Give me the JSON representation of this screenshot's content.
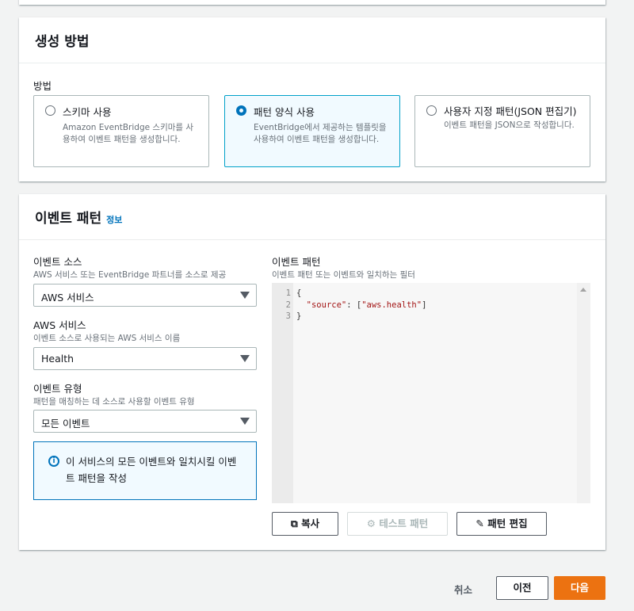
{
  "method_panel": {
    "title": "생성 방법",
    "label": "방법",
    "options": [
      {
        "label": "스키마 사용",
        "desc": "Amazon EventBridge 스키마를 사용하여 이벤트 패턴을 생성합니다.",
        "selected": false
      },
      {
        "label": "패턴 양식 사용",
        "desc": "EventBridge에서 제공하는 템플릿을 사용하여 이벤트 패턴을 생성합니다.",
        "selected": true
      },
      {
        "label": "사용자 지정 패턴(JSON 편집기)",
        "desc": "이벤트 패턴을 JSON으로 작성합니다.",
        "selected": false
      }
    ]
  },
  "pattern_panel": {
    "title": "이벤트 패턴",
    "info": "정보",
    "source": {
      "label": "이벤트 소스",
      "desc": "AWS 서비스 또는 EventBridge 파트너를 소스로 제공",
      "value": "AWS 서비스"
    },
    "service": {
      "label": "AWS 서비스",
      "desc": "이벤트 소스로 사용되는 AWS 서비스 이름",
      "value": "Health"
    },
    "type": {
      "label": "이벤트 유형",
      "desc": "패턴을 매칭하는 데 소스로 사용할 이벤트 유형",
      "value": "모든 이벤트"
    },
    "alert": "이 서비스의 모든 이벤트와 일치시킬 이벤트 패턴을 작성",
    "editor": {
      "label": "이벤트 패턴",
      "desc": "이벤트 패턴 또는 이벤트와 일치하는 필터",
      "lines": [
        "1",
        "2",
        "3"
      ],
      "open": "{",
      "key": "\"source\"",
      "colon": ": [",
      "val": "\"aws.health\"",
      "close_br": "]",
      "close": "}"
    },
    "copy": "복사",
    "test": "테스트 패턴",
    "edit": "패턴 편집"
  },
  "footer": {
    "cancel": "취소",
    "prev": "이전",
    "next": "다음"
  }
}
